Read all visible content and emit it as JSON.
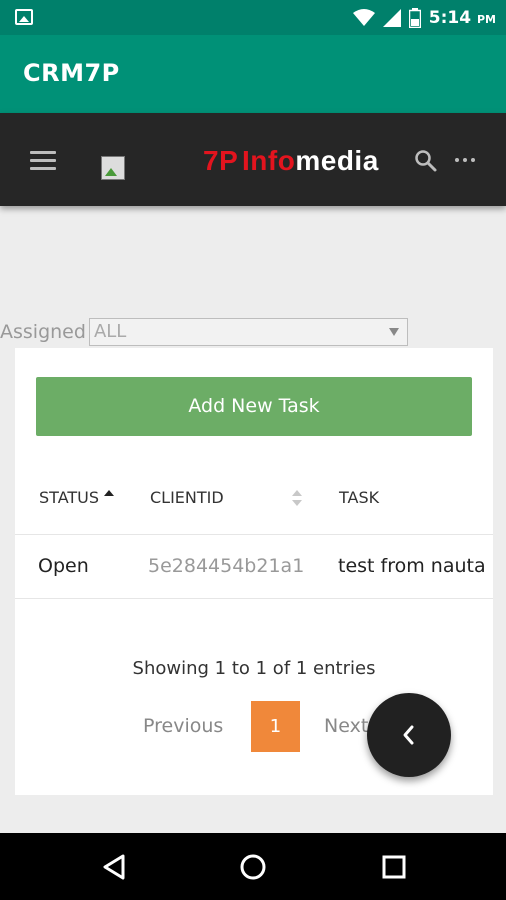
{
  "status_bar": {
    "time": "5:14",
    "ampm": "PM",
    "icons": [
      "image-notification-icon",
      "wifi-icon",
      "signal-icon",
      "battery-icon"
    ]
  },
  "app": {
    "title": "CRM7P"
  },
  "web_nav": {
    "brand_part1": "7P",
    "brand_part2": "Info",
    "brand_part3": "media",
    "icons": [
      "hamburger-menu-icon",
      "broken-image-icon",
      "search-icon",
      "more-horizontal-icon"
    ]
  },
  "filter": {
    "label": "Assigned",
    "selected": "ALL"
  },
  "card": {
    "add_button": "Add New Task",
    "columns": [
      "STATUS",
      "CLIENTID",
      "TASK"
    ],
    "rows": [
      {
        "status": "Open",
        "clientid": "5e284454b21a1",
        "task": "test from nauta"
      }
    ],
    "info": "Showing 1 to 1 of 1 entries",
    "pagination": {
      "previous": "Previous",
      "current": "1",
      "next": "Next"
    }
  },
  "colors": {
    "status_bar": "#00806b",
    "app_bar": "#009177",
    "nav_bg": "#262626",
    "brand_red": "#e3141e",
    "add_button": "#6cad66",
    "page_active": "#f0883a"
  },
  "fab": {
    "icon": "chevron-left-icon"
  },
  "system_nav": {
    "icons": [
      "back-icon",
      "home-icon",
      "recents-icon"
    ]
  }
}
